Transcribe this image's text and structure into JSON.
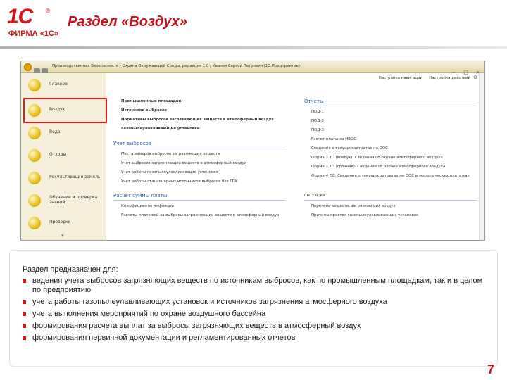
{
  "slide": {
    "logo_mark": "1С",
    "logo_reg": "®",
    "logo_firm": "ФИРМА «1С»",
    "title": "Раздел «Воздух»",
    "page_number": "7",
    "accent_color": "#c8101a"
  },
  "window": {
    "title": "Производственная Безопасность - Охрана Окружающей Среды, редакция 1.0 / Иванов Сергей Петрович (1С:Предприятие)",
    "sidebar": [
      {
        "label": "Главное",
        "icon": "home-icon"
      },
      {
        "label": "Воздух",
        "icon": "air-icon"
      },
      {
        "label": "Вода",
        "icon": "water-icon"
      },
      {
        "label": "Отходы",
        "icon": "waste-icon"
      },
      {
        "label": "Рекультивация земель",
        "icon": "land-icon"
      },
      {
        "label": "Обучение и проверка знаний",
        "icon": "books-icon"
      },
      {
        "label": "Проверки",
        "icon": "checklist-icon"
      }
    ],
    "nav": {
      "setup_navigation": "Настройка навигации",
      "setup_actions": "Настройка действий"
    },
    "left_column": {
      "top_items": [
        "Промышленные площадки",
        "Источники выбросов",
        "Нормативы выбросов загрязняющих веществ в атмосферный воздух",
        "Газопылеулавливающие установки"
      ],
      "group1_title": "Учет выбросов",
      "group1_items": [
        "Места замеров выбросов загрязняющих веществ",
        "Учет выбросов загрязняющих веществ в атмосферный воздух",
        "Учет работы газопылеулавливающих установок",
        "Учет работы стационарных источников выбросов без ГПУ"
      ],
      "group2_title": "Расчет суммы платы",
      "group2_items": [
        "Коэффициенты инфляции",
        "Расчеты платежей за выбросы загрязняющих веществ в атмосферный воздух"
      ]
    },
    "right_column": {
      "reports_title": "Отчеты",
      "reports": [
        "ПОД-1",
        "ПОД-2",
        "ПОД-3",
        "Расчет платы за НВОС",
        "Сведения о текущих затратах на ООС",
        "Форма 2 ТП (воздух): Сведения об охране атмосферного воздуха",
        "Форма 2 ТП (срочная): Сведения об охране атмосферного воздуха",
        "Форма 4 ОС: Сведения о текущих затратах на ООС и экологических платежах"
      ],
      "see_also_title": "См. также",
      "see_also": [
        "Перечень веществ, загрязняющих воздух",
        "Причины простоя газопылеулавливающих установок"
      ]
    }
  },
  "description": {
    "intro": "Раздел предназначен для:",
    "items": [
      "ведения учета выбросов загрязняющих веществ по источникам выбросов, как по промышленным площадкам, так и в целом по предприятию",
      "учета работы газопылеулавливающих установок и источников загрязнения атмосферного воздуха",
      "учета выполнения мероприятий по охране воздушного бассейна",
      "формирования расчета выплат за выбросы загрязняющих веществ в атмосферный воздух",
      "формирования первичной документации и регламентированных отчетов"
    ],
    "bullet_color": "#d4121b"
  }
}
